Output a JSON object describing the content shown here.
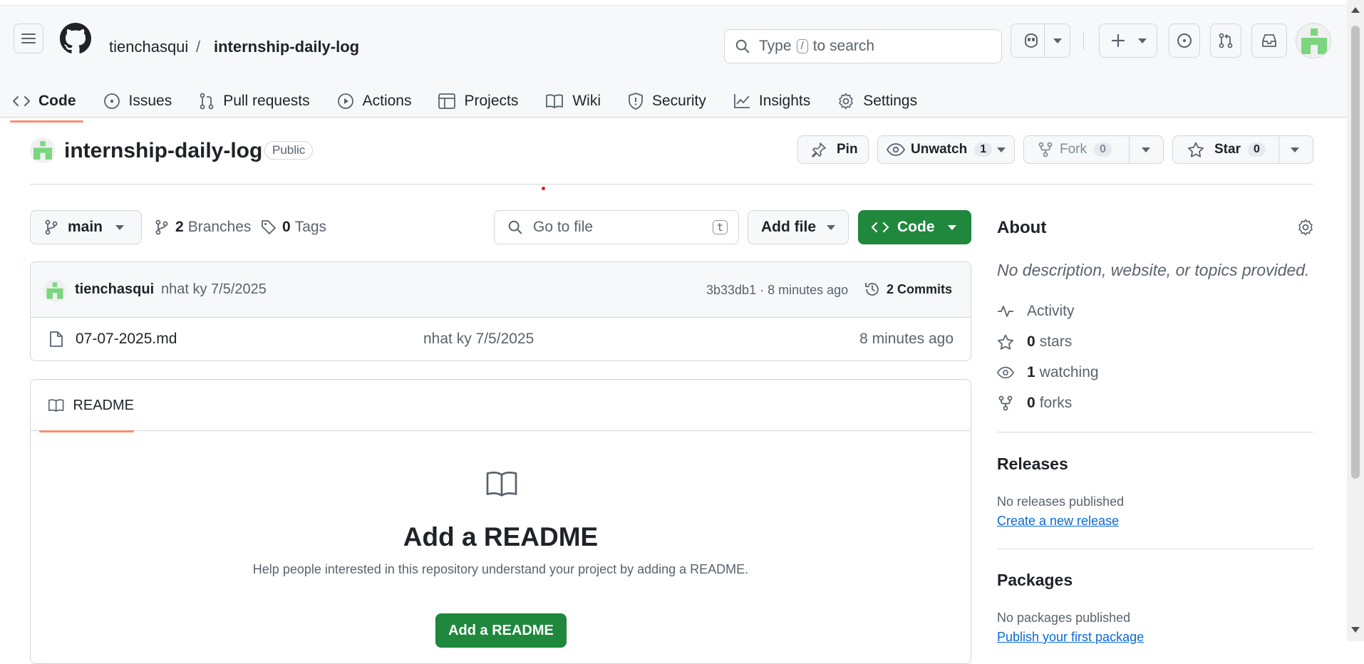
{
  "header": {
    "owner": "tienchasqui",
    "separator": "/",
    "repo": "internship-daily-log",
    "search": {
      "prefix": "Type",
      "key": "/",
      "suffix": "to search"
    }
  },
  "tabs": [
    {
      "label": "Code",
      "icon": "code-icon",
      "active": true
    },
    {
      "label": "Issues",
      "icon": "issue-icon"
    },
    {
      "label": "Pull requests",
      "icon": "pull-request-icon"
    },
    {
      "label": "Actions",
      "icon": "play-icon"
    },
    {
      "label": "Projects",
      "icon": "table-icon"
    },
    {
      "label": "Wiki",
      "icon": "book-icon"
    },
    {
      "label": "Security",
      "icon": "shield-icon"
    },
    {
      "label": "Insights",
      "icon": "graph-icon"
    },
    {
      "label": "Settings",
      "icon": "gear-icon"
    }
  ],
  "repo_head": {
    "name": "internship-daily-log",
    "visibility": "Public",
    "pin": "Pin",
    "unwatch": "Unwatch",
    "watch_count": "1",
    "fork": "Fork",
    "fork_count": "0",
    "star": "Star",
    "star_count": "0"
  },
  "toolbar": {
    "branch": "main",
    "branches_count": "2",
    "branches_label": "Branches",
    "tags_count": "0",
    "tags_label": "Tags",
    "goto_placeholder": "Go to file",
    "goto_key": "t",
    "add_file": "Add file",
    "code": "Code"
  },
  "commit": {
    "author": "tienchasqui",
    "message": "nhat ky 7/5/2025",
    "hash_time": "3b33db1 · 8 minutes ago",
    "commits_count": "2",
    "commits_label": "Commits"
  },
  "files": [
    {
      "name": "07-07-2025.md",
      "message": "nhat ky 7/5/2025",
      "time": "8 minutes ago"
    }
  ],
  "readme": {
    "tab": "README",
    "title": "Add a README",
    "description": "Help people interested in this repository understand your project by adding a README.",
    "button": "Add a README"
  },
  "about": {
    "title": "About",
    "description": "No description, website, or topics provided.",
    "activity": "Activity",
    "stars_count": "0",
    "stars_label": "stars",
    "watching_count": "1",
    "watching_label": "watching",
    "forks_count": "0",
    "forks_label": "forks"
  },
  "releases": {
    "title": "Releases",
    "empty": "No releases published",
    "link": "Create a new release"
  },
  "packages": {
    "title": "Packages",
    "empty": "No packages published",
    "link": "Publish your first package"
  },
  "colors": {
    "accent_green": "#1f883d",
    "tab_underline": "#fd8c73",
    "link": "#0969da",
    "avatar_green": "#7bd67f"
  }
}
